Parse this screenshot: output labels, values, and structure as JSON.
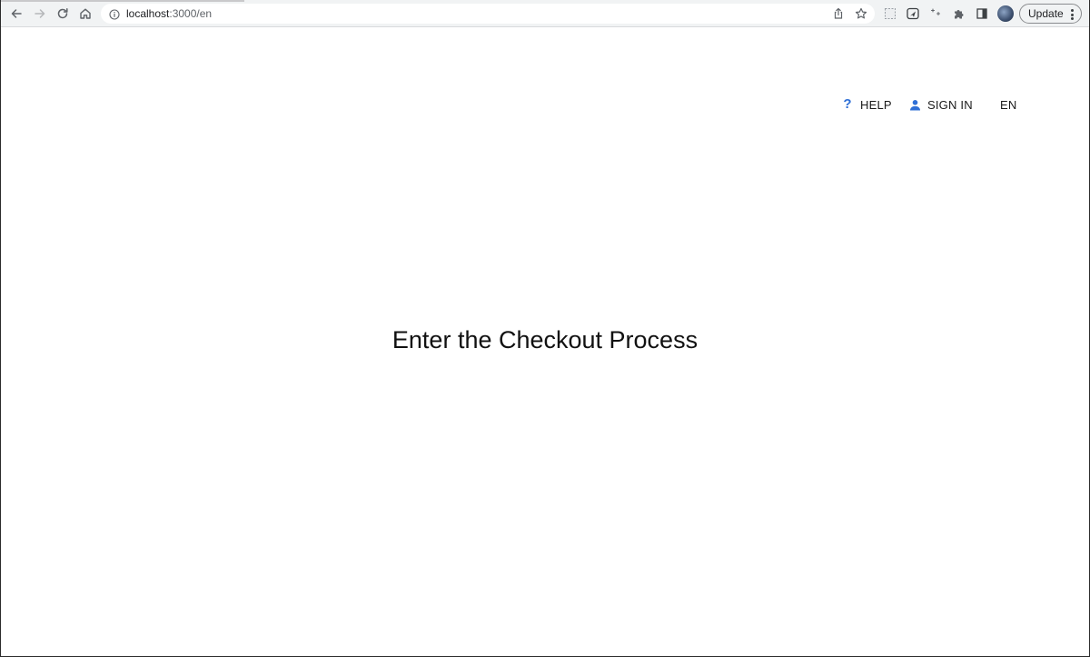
{
  "browser": {
    "url_host": "localhost",
    "url_path": ":3000/en",
    "update_label": "Update",
    "icons": {
      "back": "back-arrow-icon",
      "forward": "forward-arrow-icon",
      "reload": "reload-icon",
      "home": "home-icon",
      "site_info": "info-icon",
      "share": "share-icon",
      "bookmark": "star-icon",
      "extensions": [
        "screenshot-extension-icon",
        "send-extension-icon",
        "sparkle-extension-icon",
        "puzzle-icon",
        "side-panel-icon"
      ],
      "profile": "avatar",
      "menu": "kebab-menu-icon"
    }
  },
  "nav": {
    "help_label": "HELP",
    "signin_label": "SIGN IN",
    "language_label": "EN",
    "accent_color": "#2f6fd6"
  },
  "main": {
    "headline": "Enter the Checkout Process"
  }
}
